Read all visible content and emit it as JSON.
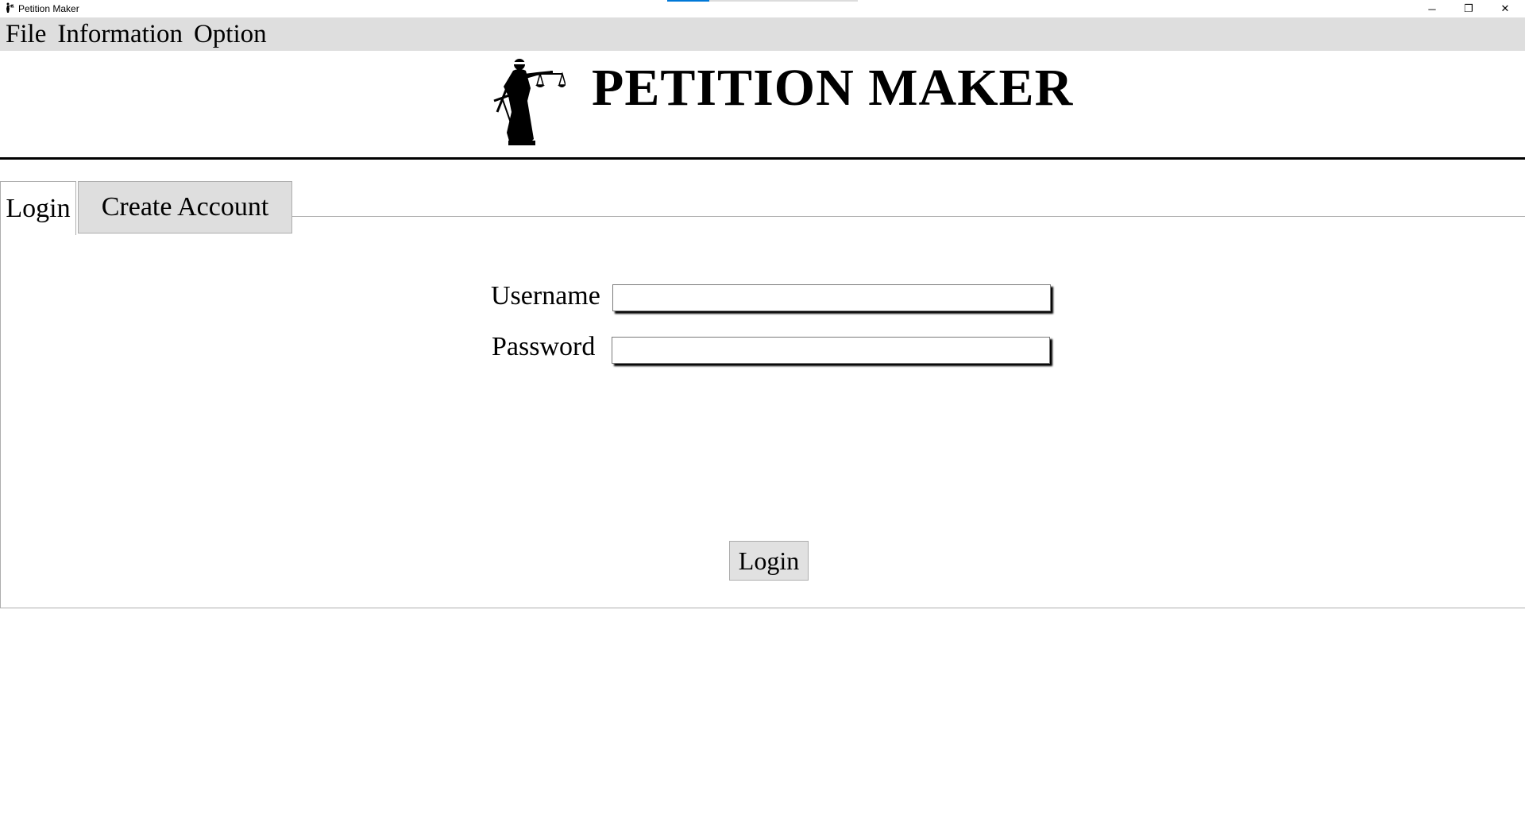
{
  "window": {
    "title": "Petition Maker",
    "minimize_glyph": "─",
    "maximize_glyph": "❐",
    "close_glyph": "✕",
    "progress_fraction": 0.22
  },
  "menu": {
    "items": [
      "File",
      "Information",
      "Option"
    ]
  },
  "header": {
    "title": "PETITION MAKER",
    "logo_icon": "lady-justice-icon"
  },
  "tabs": [
    {
      "label": "Login",
      "active": true
    },
    {
      "label": "Create Account",
      "active": false
    }
  ],
  "login_form": {
    "username_label": "Username",
    "username_value": "",
    "password_label": "Password",
    "password_value": "",
    "submit_label": "Login"
  }
}
